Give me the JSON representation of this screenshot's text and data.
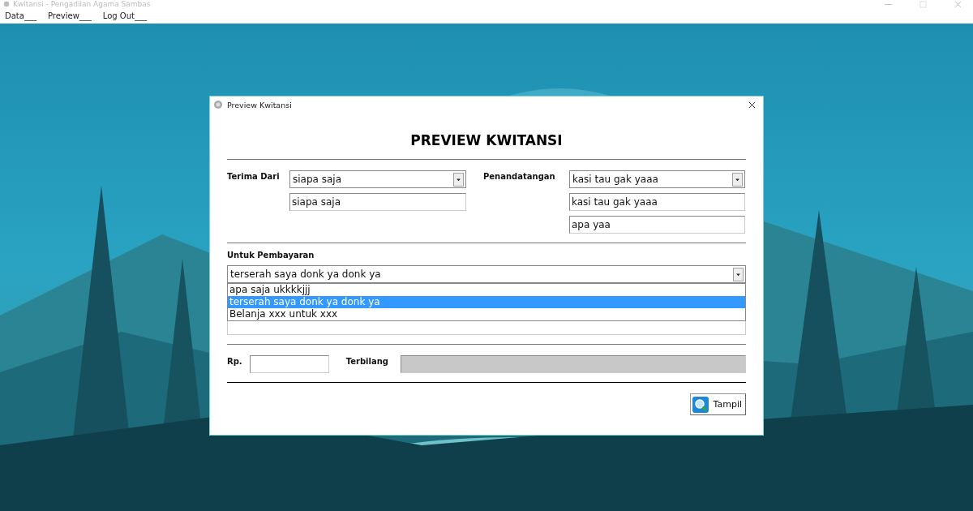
{
  "app": {
    "title": "Kwitansi - Pengadilan Agama Sambas",
    "menu": [
      "Data___",
      "Preview___",
      "Log Out___"
    ]
  },
  "dialog": {
    "title": "Preview Kwitansi",
    "heading": "PREVIEW KWITANSI",
    "terima_dari": {
      "label": "Terima Dari",
      "combo_value": "siapa saja",
      "field_value": "siapa saja"
    },
    "penandatangan": {
      "label": "Penandatangan",
      "combo_value": "kasi tau gak yaaa",
      "fields": [
        "kasi tau gak yaaa",
        "apa yaa"
      ]
    },
    "untuk_pembayaran": {
      "label": "Untuk Pembayaran",
      "combo_value": "terserah saya donk ya donk ya",
      "expanded": true,
      "options": [
        {
          "label": "apa saja ukkkkjjj",
          "selected": false
        },
        {
          "label": "terserah saya donk ya donk ya",
          "selected": true
        },
        {
          "label": "Belanja xxx untuk xxx",
          "selected": false
        }
      ]
    },
    "rp": {
      "label": "Rp."
    },
    "terbilang": {
      "label": "Terbilang",
      "disabled": true
    },
    "buttons": [
      {
        "label": "Tampil"
      }
    ]
  }
}
